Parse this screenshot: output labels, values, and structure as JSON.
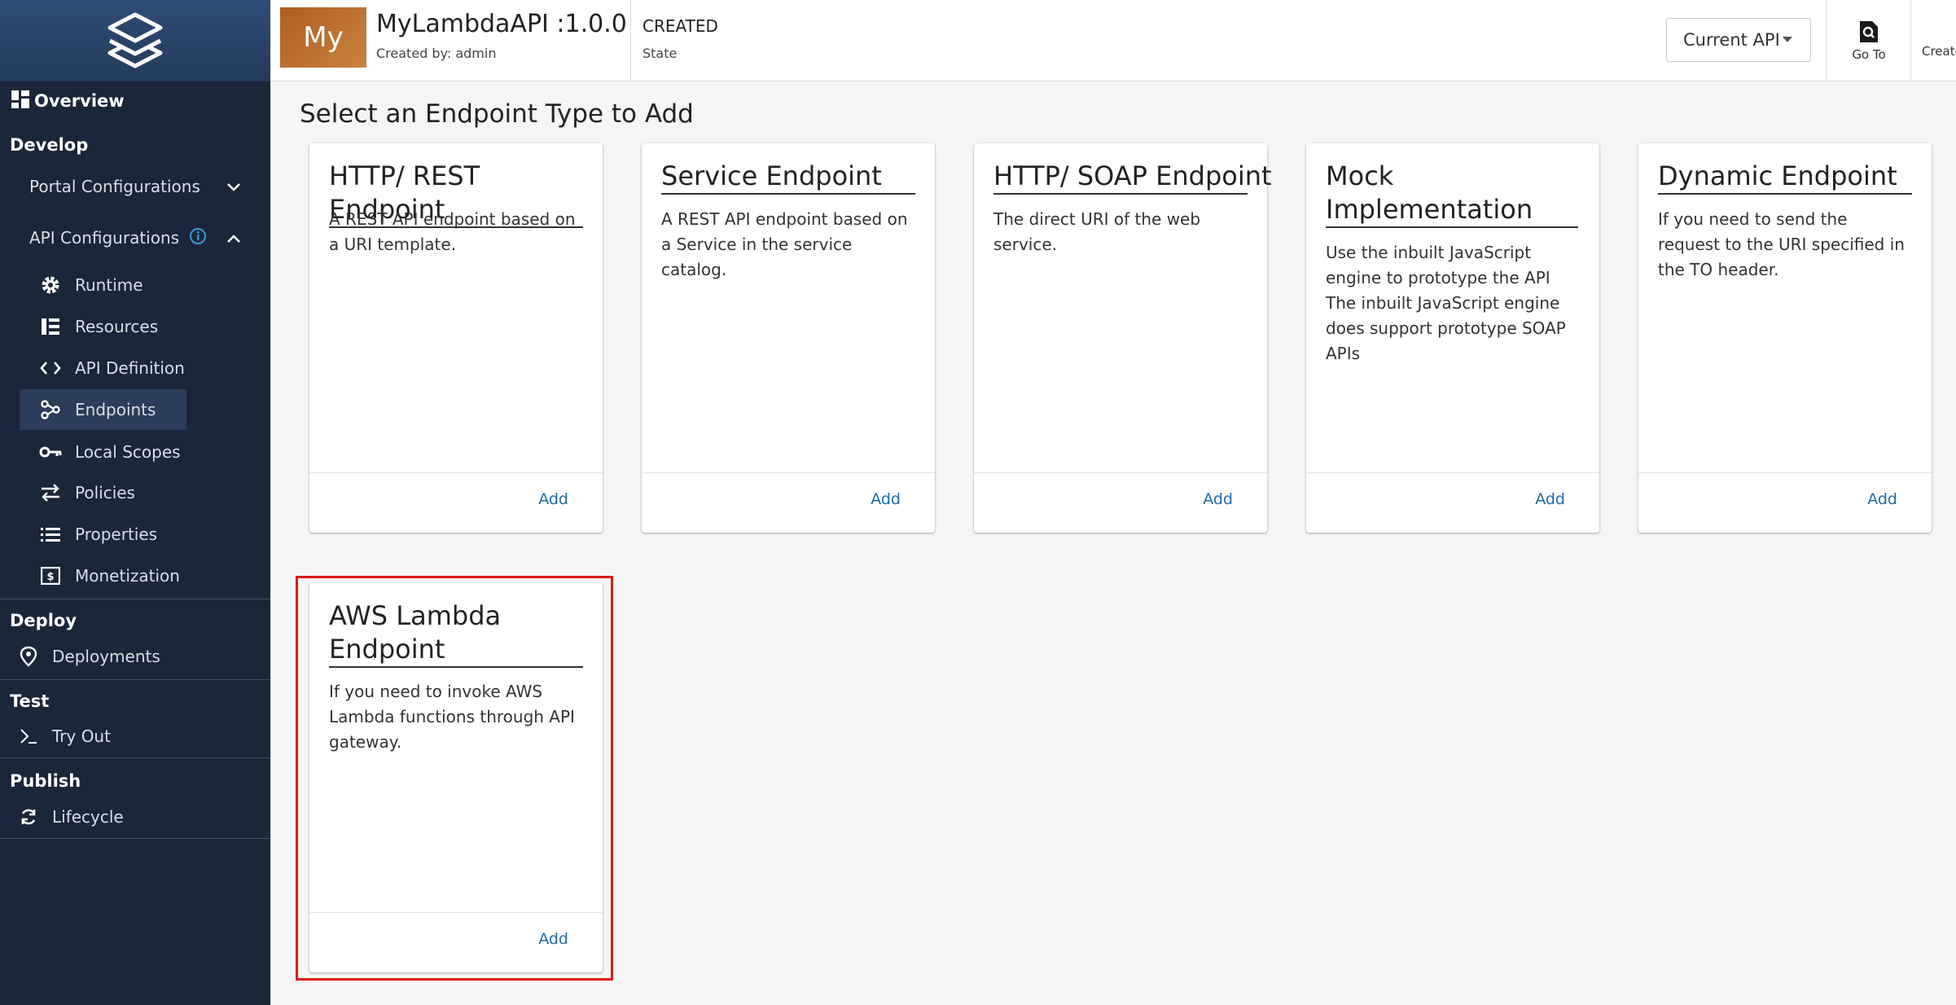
{
  "sidebar": {
    "overview_label": "Overview",
    "develop": {
      "title": "Develop",
      "portal_configurations": "Portal Configurations",
      "api_configurations": "API Configurations",
      "items": [
        {
          "label": "Runtime",
          "icon": "gear-icon"
        },
        {
          "label": "Resources",
          "icon": "resources-icon"
        },
        {
          "label": "API Definition",
          "icon": "code-icon"
        },
        {
          "label": "Endpoints",
          "icon": "endpoints-icon",
          "active": true
        },
        {
          "label": "Local Scopes",
          "icon": "key-icon"
        },
        {
          "label": "Policies",
          "icon": "arrows-icon"
        },
        {
          "label": "Properties",
          "icon": "list-icon"
        },
        {
          "label": "Monetization",
          "icon": "money-icon"
        }
      ]
    },
    "deploy": {
      "title": "Deploy",
      "deployments": "Deployments"
    },
    "test": {
      "title": "Test",
      "try_out": "Try Out"
    },
    "publish": {
      "title": "Publish",
      "lifecycle": "Lifecycle"
    }
  },
  "header": {
    "avatar_text": "My",
    "api_title": "MyLambdaAPI :1.0.0",
    "created_by": "Created by: admin",
    "state_value": "CREATED",
    "state_label": "State",
    "current_api": "Current API",
    "go_to": "Go To",
    "create_partial": "Create"
  },
  "main": {
    "title": "Select an Endpoint Type to Add",
    "cards": [
      {
        "title": "HTTP/ REST Endpoint",
        "description": "A REST API endpoint based on a URI template.",
        "add": "Add"
      },
      {
        "title": "Service Endpoint",
        "description": "A REST API endpoint based on a Service in the service catalog.",
        "add": "Add"
      },
      {
        "title": "HTTP/ SOAP Endpoint",
        "description": "The direct URI of the web service.",
        "add": "Add"
      },
      {
        "title": "Mock Implementation",
        "description": "Use the inbuilt JavaScript engine to prototype the API The inbuilt JavaScript engine does support prototype SOAP APIs",
        "add": "Add"
      },
      {
        "title": "Dynamic Endpoint",
        "description": "If you need to send the request to the URI specified in the TO header.",
        "add": "Add"
      },
      {
        "title": "AWS Lambda Endpoint",
        "description": "If you need to invoke AWS Lambda functions through API gateway.",
        "add": "Add"
      }
    ]
  },
  "colors": {
    "sidebar_bg": "#1a2639",
    "accent_link": "#1e6aa8",
    "highlight": "#e01818"
  }
}
